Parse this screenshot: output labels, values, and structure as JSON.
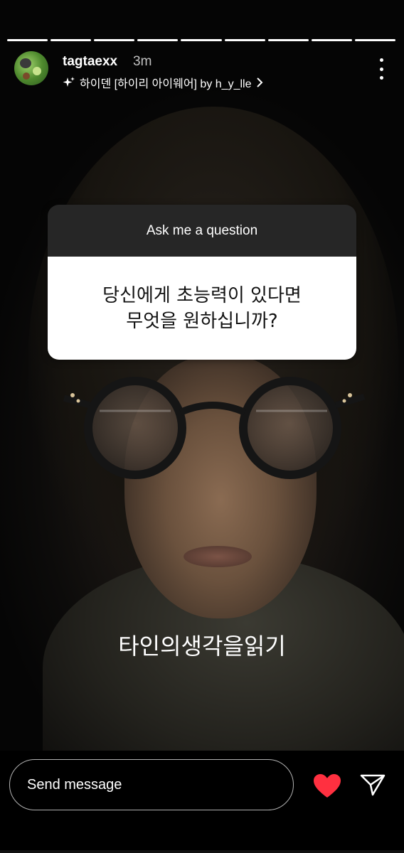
{
  "story": {
    "username": "tagtaexx",
    "time": "3m",
    "filter_label": "하이덴 [하이리 아이웨어] by h_y_lle",
    "progress_total": 9,
    "progress_done": 9
  },
  "question_sticker": {
    "header": "Ask me a question",
    "line1": "당신에게 초능력이 있다면",
    "line2": "무엇을 원하십니까?"
  },
  "caption": "타인의생각을읽기",
  "reply": {
    "placeholder": "Send message"
  },
  "colors": {
    "heart": "#ff3040",
    "sticker_header_bg": "#262626",
    "sticker_body_bg": "#ffffff"
  },
  "icons": [
    "avatar",
    "sparkle-icon",
    "chevron-right-icon",
    "more-vertical-icon",
    "heart-icon",
    "send-icon"
  ]
}
